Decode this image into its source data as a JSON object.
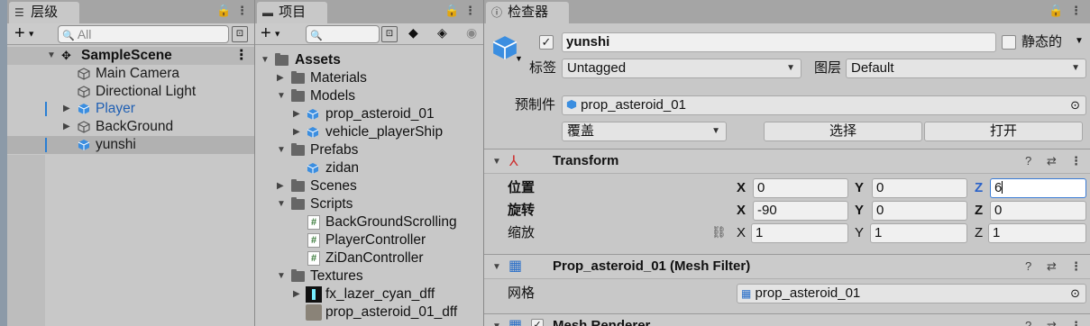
{
  "hierarchy": {
    "tab_label": "层级",
    "search_placeholder": "All",
    "scene_name": "SampleScene",
    "items": [
      {
        "label": "Main Camera",
        "color": "#1a1a1a"
      },
      {
        "label": "Directional Light",
        "color": "#1a1a1a"
      },
      {
        "label": "Player",
        "color": "#1f5fb3"
      },
      {
        "label": "BackGround",
        "color": "#1a1a1a"
      },
      {
        "label": "yunshi",
        "color": "#1a1a1a"
      }
    ]
  },
  "project": {
    "tab_label": "项目",
    "root": "Assets",
    "items": [
      {
        "label": "Materials"
      },
      {
        "label": "Models"
      },
      {
        "label": "prop_asteroid_01"
      },
      {
        "label": "vehicle_playerShip"
      },
      {
        "label": "Prefabs"
      },
      {
        "label": "zidan"
      },
      {
        "label": "Scenes"
      },
      {
        "label": "Scripts"
      },
      {
        "label": "BackGroundScrolling"
      },
      {
        "label": "PlayerController"
      },
      {
        "label": "ZiDanController"
      },
      {
        "label": "Textures"
      },
      {
        "label": "fx_lazer_cyan_dff"
      },
      {
        "label": "prop_asteroid_01_dff"
      }
    ]
  },
  "inspector": {
    "tab_label": "检查器",
    "object_name": "yunshi",
    "static_label": "静态的",
    "tag_label": "标签",
    "tag_value": "Untagged",
    "layer_label": "图层",
    "layer_value": "Default",
    "prefab_label": "预制件",
    "prefab_value": "prop_asteroid_01",
    "override_label": "覆盖",
    "select_label": "选择",
    "open_label": "打开",
    "transform": {
      "title": "Transform",
      "position_label": "位置",
      "rotation_label": "旋转",
      "scale_label": "缩放",
      "axis_x": "X",
      "axis_y": "Y",
      "axis_z": "Z",
      "position": {
        "x": "0",
        "y": "0",
        "z": "6"
      },
      "rotation": {
        "x": "-90",
        "y": "0",
        "z": "0"
      },
      "scale": {
        "x": "1",
        "y": "1",
        "z": "1"
      }
    },
    "mesh_filter": {
      "title": "Prop_asteroid_01 (Mesh Filter)",
      "mesh_label": "网格",
      "mesh_value": "prop_asteroid_01"
    },
    "mesh_renderer": {
      "title": "Mesh Renderer"
    }
  },
  "colors": {
    "accent_blue": "#2a7fd4",
    "selection": "#b1b1b1"
  }
}
